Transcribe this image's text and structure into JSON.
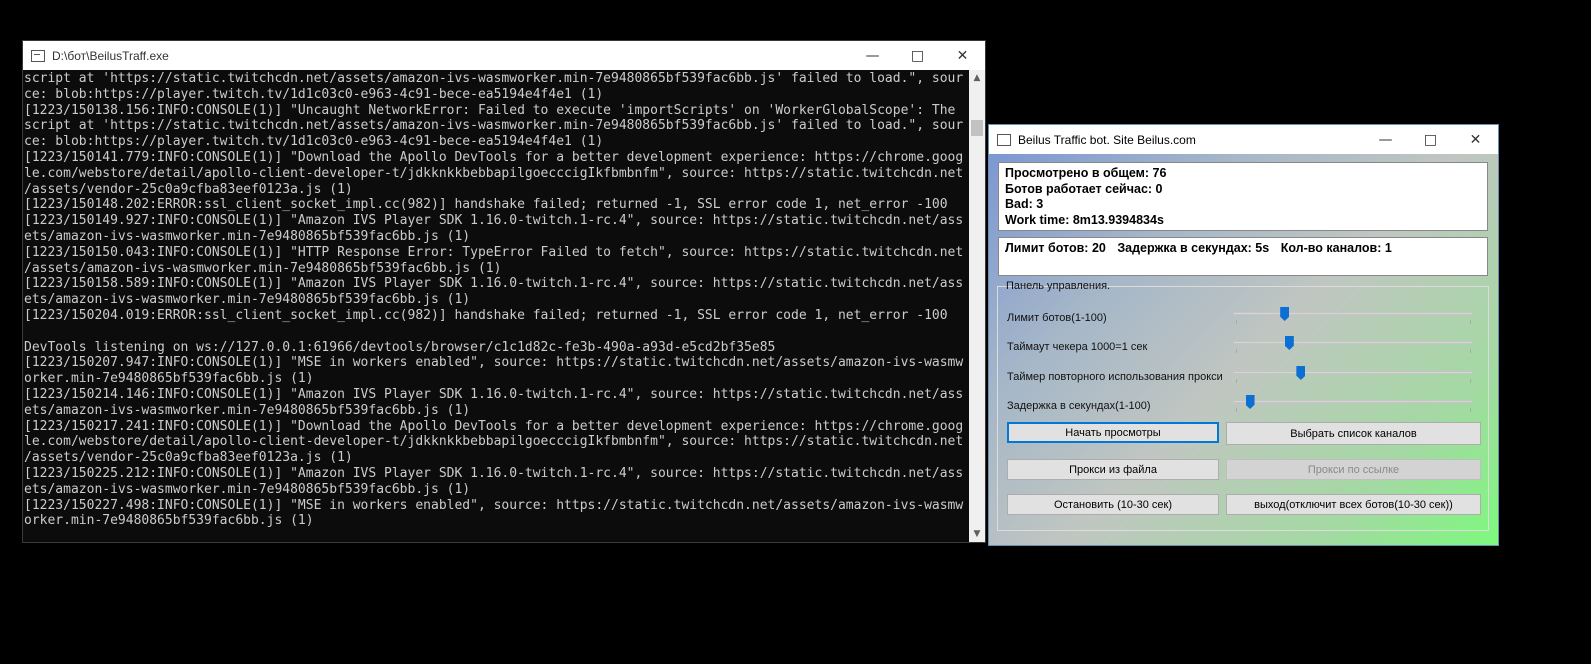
{
  "console": {
    "title": "D:\\бот\\BeilusTraff.exe",
    "lines": [
      "script at 'https://static.twitchcdn.net/assets/amazon-ivs-wasmworker.min-7e9480865bf539fac6bb.js' failed to load.\", sour",
      "ce: blob:https://player.twitch.tv/1d1c03c0-e963-4c91-bece-ea5194e4f4e1 (1)",
      "[1223/150138.156:INFO:CONSOLE(1)] \"Uncaught NetworkError: Failed to execute 'importScripts' on 'WorkerGlobalScope': The",
      "script at 'https://static.twitchcdn.net/assets/amazon-ivs-wasmworker.min-7e9480865bf539fac6bb.js' failed to load.\", sour",
      "ce: blob:https://player.twitch.tv/1d1c03c0-e963-4c91-bece-ea5194e4f4e1 (1)",
      "[1223/150141.779:INFO:CONSOLE(1)] \"Download the Apollo DevTools for a better development experience: https://chrome.goog",
      "le.com/webstore/detail/apollo-client-developer-t/jdkknkkbebbapilgoecccigIkfbmbnfm\", source: https://static.twitchcdn.net",
      "/assets/vendor-25c0a9cfba83eef0123a.js (1)",
      "[1223/150148.202:ERROR:ssl_client_socket_impl.cc(982)] handshake failed; returned -1, SSL error code 1, net_error -100",
      "[1223/150149.927:INFO:CONSOLE(1)] \"Amazon IVS Player SDK 1.16.0-twitch.1-rc.4\", source: https://static.twitchcdn.net/ass",
      "ets/amazon-ivs-wasmworker.min-7e9480865bf539fac6bb.js (1)",
      "[1223/150150.043:INFO:CONSOLE(1)] \"HTTP Response Error: TypeError Failed to fetch\", source: https://static.twitchcdn.net",
      "/assets/amazon-ivs-wasmworker.min-7e9480865bf539fac6bb.js (1)",
      "[1223/150158.589:INFO:CONSOLE(1)] \"Amazon IVS Player SDK 1.16.0-twitch.1-rc.4\", source: https://static.twitchcdn.net/ass",
      "ets/amazon-ivs-wasmworker.min-7e9480865bf539fac6bb.js (1)",
      "[1223/150204.019:ERROR:ssl_client_socket_impl.cc(982)] handshake failed; returned -1, SSL error code 1, net_error -100",
      "",
      "DevTools listening on ws://127.0.0.1:61966/devtools/browser/c1c1d82c-fe3b-490a-a93d-e5cd2bf35e85",
      "[1223/150207.947:INFO:CONSOLE(1)] \"MSE in workers enabled\", source: https://static.twitchcdn.net/assets/amazon-ivs-wasmw",
      "orker.min-7e9480865bf539fac6bb.js (1)",
      "[1223/150214.146:INFO:CONSOLE(1)] \"Amazon IVS Player SDK 1.16.0-twitch.1-rc.4\", source: https://static.twitchcdn.net/ass",
      "ets/amazon-ivs-wasmworker.min-7e9480865bf539fac6bb.js (1)",
      "[1223/150217.241:INFO:CONSOLE(1)] \"Download the Apollo DevTools for a better development experience: https://chrome.goog",
      "le.com/webstore/detail/apollo-client-developer-t/jdkknkkbebbapilgoecccigIkfbmbnfm\", source: https://static.twitchcdn.net",
      "/assets/vendor-25c0a9cfba83eef0123a.js (1)",
      "[1223/150225.212:INFO:CONSOLE(1)] \"Amazon IVS Player SDK 1.16.0-twitch.1-rc.4\", source: https://static.twitchcdn.net/ass",
      "ets/amazon-ivs-wasmworker.min-7e9480865bf539fac6bb.js (1)",
      "[1223/150227.498:INFO:CONSOLE(1)] \"MSE in workers enabled\", source: https://static.twitchcdn.net/assets/amazon-ivs-wasmw",
      "orker.min-7e9480865bf539fac6bb.js (1)"
    ]
  },
  "bot": {
    "title": "Beilus Traffic bot. Site Beilus.com",
    "stats": {
      "viewed": "Просмотрено в общем: 76",
      "working": "Ботов работает сейчас: 0",
      "bad": "Bad: 3",
      "work_time": "Work time: 8m13.9394834s"
    },
    "limits": {
      "bot_limit": "Лимит ботов: 20",
      "delay": "Задержка в секундах: 5s",
      "channels": "Кол-во каналов: 1"
    },
    "panel": {
      "legend": "Панель управления.",
      "sliders": [
        {
          "label": "Лимит ботов(1-100)",
          "value": 0.2
        },
        {
          "label": "Таймаут чекера 1000=1 сек",
          "value": 0.22
        },
        {
          "label": "Таймер повторного использования прокси",
          "value": 0.27
        },
        {
          "label": "Задержка в секундах(1-100)",
          "value": 0.05
        }
      ],
      "buttons": {
        "start": "Начать просмотры",
        "choose_channels": "Выбрать список каналов",
        "proxy_file": "Прокси из файла",
        "proxy_url": "Прокси по ссылке",
        "stop": "Остановить (10-30 сек)",
        "exit": "выход(отключит всех ботов(10-30 сек))"
      }
    }
  },
  "colors": {
    "accent": "#0078d7",
    "console_bg": "#0c0c0c",
    "console_text": "#cccccc"
  }
}
